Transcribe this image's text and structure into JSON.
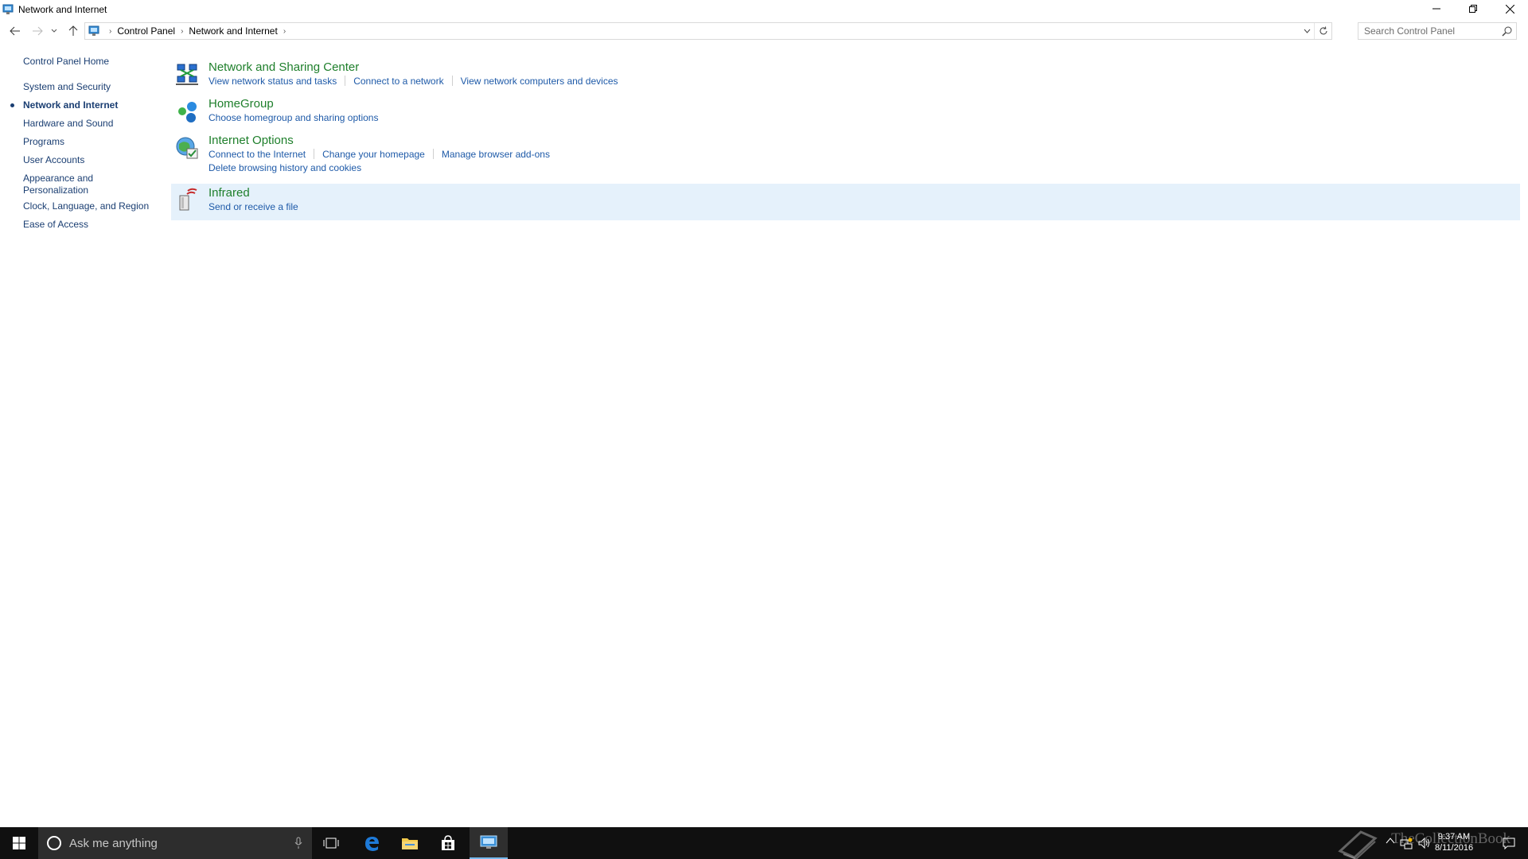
{
  "window": {
    "title": "Network and Internet"
  },
  "address": {
    "crumbs": [
      "Control Panel",
      "Network and Internet"
    ]
  },
  "search": {
    "placeholder": "Search Control Panel"
  },
  "leftnav": {
    "home": "Control Panel Home",
    "items": [
      {
        "label": "System and Security",
        "current": false
      },
      {
        "label": "Network and Internet",
        "current": true
      },
      {
        "label": "Hardware and Sound",
        "current": false
      },
      {
        "label": "Programs",
        "current": false
      },
      {
        "label": "User Accounts",
        "current": false
      },
      {
        "label": "Appearance and Personalization",
        "current": false
      },
      {
        "label": "Clock, Language, and Region",
        "current": false
      },
      {
        "label": "Ease of Access",
        "current": false
      }
    ]
  },
  "categories": [
    {
      "title": "Network and Sharing Center",
      "icon": "network-sharing-center-icon",
      "links": [
        "View network status and tasks",
        "Connect to a network",
        "View network computers and devices"
      ]
    },
    {
      "title": "HomeGroup",
      "icon": "homegroup-icon",
      "links": [
        "Choose homegroup and sharing options"
      ]
    },
    {
      "title": "Internet Options",
      "icon": "internet-options-icon",
      "links": [
        "Connect to the Internet",
        "Change your homepage",
        "Manage browser add-ons",
        "Delete browsing history and cookies"
      ]
    },
    {
      "title": "Infrared",
      "icon": "infrared-icon",
      "links": [
        "Send or receive a file"
      ]
    }
  ],
  "taskbar": {
    "search_placeholder": "Ask me anything",
    "clock_time": "9:37 AM",
    "clock_date": "8/11/2016",
    "watermark": "TheCollectionBook"
  },
  "colors": {
    "category_title": "#1e7f2b",
    "link": "#1e5aa8",
    "nav_link": "#1a3e72",
    "hover_row": "#e5f1fb",
    "taskbar": "#101010"
  }
}
